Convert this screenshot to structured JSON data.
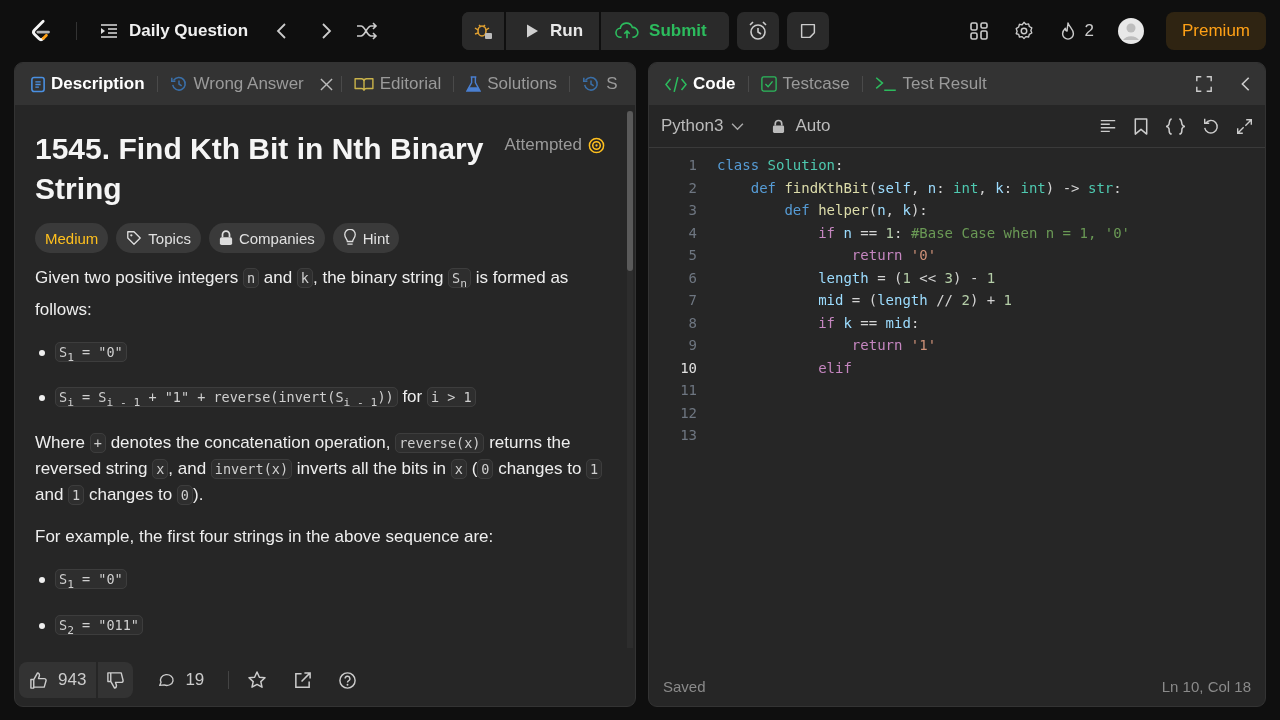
{
  "topbar": {
    "title": "Daily Question",
    "run": "Run",
    "submit": "Submit",
    "streak": "2",
    "premium": "Premium"
  },
  "left_tabs": [
    {
      "label": "Description",
      "kind": "description",
      "selected": true
    },
    {
      "label": "Wrong Answer",
      "kind": "submission",
      "selected": false,
      "closable": true
    },
    {
      "label": "Editorial",
      "kind": "editorial",
      "selected": false
    },
    {
      "label": "Solutions",
      "kind": "solutions",
      "selected": false
    },
    {
      "label": "S",
      "kind": "submission",
      "selected": false
    }
  ],
  "problem": {
    "title": "1545. Find Kth Bit in Nth Binary String",
    "status": "Attempted",
    "tags": [
      {
        "label": "Medium",
        "kind": "difficulty"
      },
      {
        "label": "Topics",
        "kind": "topics"
      },
      {
        "label": "Companies",
        "kind": "companies"
      },
      {
        "label": "Hint",
        "kind": "hint"
      }
    ],
    "blocks": [
      {
        "kind": "paragraph",
        "parts": [
          {
            "kind": "text",
            "text": "Given two positive integers "
          },
          {
            "kind": "code",
            "text": "n"
          },
          {
            "kind": "text",
            "text": " and "
          },
          {
            "kind": "code",
            "text": "k"
          },
          {
            "kind": "text",
            "text": ", the binary string "
          },
          {
            "kind": "code",
            "text": "S$_{n}$"
          },
          {
            "kind": "text",
            "text": " is formed as follows:"
          }
        ]
      },
      {
        "kind": "bullet",
        "parts": [
          {
            "kind": "code",
            "text": "S$_{1}$ = \"0\""
          }
        ]
      },
      {
        "kind": "bullet",
        "parts": [
          {
            "kind": "code",
            "text": "S$_{i}$ = S$_{i - 1}$ + \"1\" + reverse(invert(S$_{i - 1}$))"
          },
          {
            "kind": "text",
            "text": " for "
          },
          {
            "kind": "code",
            "text": "i > 1"
          }
        ]
      },
      {
        "kind": "paragraph",
        "parts": [
          {
            "kind": "text",
            "text": "Where "
          },
          {
            "kind": "code",
            "text": "+"
          },
          {
            "kind": "text",
            "text": " denotes the concatenation operation, "
          },
          {
            "kind": "code",
            "text": "reverse(x)"
          },
          {
            "kind": "text",
            "text": " returns the reversed string "
          },
          {
            "kind": "code",
            "text": "x"
          },
          {
            "kind": "text",
            "text": ", and "
          },
          {
            "kind": "code",
            "text": "invert(x)"
          },
          {
            "kind": "text",
            "text": " inverts all the bits in "
          },
          {
            "kind": "code",
            "text": "x"
          },
          {
            "kind": "text",
            "text": " ("
          },
          {
            "kind": "code",
            "text": "0"
          },
          {
            "kind": "text",
            "text": " changes to "
          },
          {
            "kind": "code",
            "text": "1"
          },
          {
            "kind": "text",
            "text": " and "
          },
          {
            "kind": "code",
            "text": "1"
          },
          {
            "kind": "text",
            "text": " changes to "
          },
          {
            "kind": "code",
            "text": "0"
          },
          {
            "kind": "text",
            "text": ")."
          }
        ]
      },
      {
        "kind": "paragraph",
        "parts": [
          {
            "kind": "text",
            "text": "For example, the first four strings in the above sequence are:"
          }
        ]
      },
      {
        "kind": "bullet",
        "parts": [
          {
            "kind": "code",
            "text": "S$_{1}$ = \"0\""
          }
        ]
      },
      {
        "kind": "bullet",
        "parts": [
          {
            "kind": "code",
            "text": "S$_{2}$ = \"011\""
          }
        ]
      }
    ]
  },
  "footer": {
    "likes": "943",
    "comments": "19"
  },
  "right_tabs": [
    {
      "label": "Code",
      "kind": "code",
      "selected": true
    },
    {
      "label": "Testcase",
      "kind": "testcase",
      "selected": false
    },
    {
      "label": "Test Result",
      "kind": "result",
      "selected": false
    }
  ],
  "editor": {
    "language": "Python3",
    "mode": "Auto",
    "lines": [
      {
        "number": "1",
        "selected": false,
        "tokens": [
          {
            "kind": "keyword",
            "text": "class"
          },
          {
            "kind": "type",
            "text": " Solution"
          },
          {
            "kind": "plain",
            "text": ":"
          }
        ]
      },
      {
        "number": "2",
        "selected": false,
        "tokens": [
          {
            "kind": "keyword",
            "text": "    def"
          },
          {
            "kind": "function",
            "text": " findKthBit"
          },
          {
            "kind": "plain",
            "text": "("
          },
          {
            "kind": "variable",
            "text": "self"
          },
          {
            "kind": "plain",
            "text": ", "
          },
          {
            "kind": "variable",
            "text": "n"
          },
          {
            "kind": "plain",
            "text": ": "
          },
          {
            "kind": "type",
            "text": "int"
          },
          {
            "kind": "plain",
            "text": ", "
          },
          {
            "kind": "variable",
            "text": "k"
          },
          {
            "kind": "plain",
            "text": ": "
          },
          {
            "kind": "type",
            "text": "int"
          },
          {
            "kind": "plain",
            "text": ") -> "
          },
          {
            "kind": "type",
            "text": "str"
          },
          {
            "kind": "plain",
            "text": ":"
          }
        ]
      },
      {
        "number": "3",
        "selected": false,
        "tokens": [
          {
            "kind": "keyword",
            "text": "        def"
          },
          {
            "kind": "function",
            "text": " helper"
          },
          {
            "kind": "plain",
            "text": "("
          },
          {
            "kind": "variable",
            "text": "n"
          },
          {
            "kind": "plain",
            "text": ", "
          },
          {
            "kind": "variable",
            "text": "k"
          },
          {
            "kind": "plain",
            "text": "):"
          }
        ]
      },
      {
        "number": "4",
        "selected": false,
        "tokens": [
          {
            "kind": "control",
            "text": "            if"
          },
          {
            "kind": "variable",
            "text": " n"
          },
          {
            "kind": "plain",
            "text": " == "
          },
          {
            "kind": "number",
            "text": "1"
          },
          {
            "kind": "plain",
            "text": ": "
          },
          {
            "kind": "comment",
            "text": "#Base Case when n = 1, '0'"
          }
        ]
      },
      {
        "number": "5",
        "selected": false,
        "tokens": [
          {
            "kind": "control",
            "text": "                return"
          },
          {
            "kind": "string",
            "text": " '0'"
          }
        ]
      },
      {
        "number": "6",
        "selected": false,
        "tokens": [
          {
            "kind": "variable",
            "text": "            length"
          },
          {
            "kind": "plain",
            "text": " = ("
          },
          {
            "kind": "number",
            "text": "1"
          },
          {
            "kind": "plain",
            "text": " << "
          },
          {
            "kind": "number",
            "text": "3"
          },
          {
            "kind": "plain",
            "text": ") - "
          },
          {
            "kind": "number",
            "text": "1"
          }
        ]
      },
      {
        "number": "7",
        "selected": false,
        "tokens": [
          {
            "kind": "variable",
            "text": "            mid"
          },
          {
            "kind": "plain",
            "text": " = ("
          },
          {
            "kind": "variable",
            "text": "length"
          },
          {
            "kind": "plain",
            "text": " // "
          },
          {
            "kind": "number",
            "text": "2"
          },
          {
            "kind": "plain",
            "text": ") + "
          },
          {
            "kind": "number",
            "text": "1"
          }
        ]
      },
      {
        "number": "8",
        "selected": false,
        "tokens": [
          {
            "kind": "control",
            "text": "            if"
          },
          {
            "kind": "variable",
            "text": " k"
          },
          {
            "kind": "plain",
            "text": " == "
          },
          {
            "kind": "variable",
            "text": "mid"
          },
          {
            "kind": "plain",
            "text": ":"
          }
        ]
      },
      {
        "number": "9",
        "selected": false,
        "tokens": [
          {
            "kind": "control",
            "text": "                return"
          },
          {
            "kind": "string",
            "text": " '1'"
          }
        ]
      },
      {
        "number": "10",
        "selected": true,
        "tokens": [
          {
            "kind": "control",
            "text": "            elif"
          }
        ]
      },
      {
        "number": "11",
        "selected": false
      },
      {
        "number": "12",
        "selected": false
      },
      {
        "number": "13",
        "selected": false
      }
    ],
    "save_state": "Saved",
    "cursor": "Ln 10, Col 18"
  }
}
